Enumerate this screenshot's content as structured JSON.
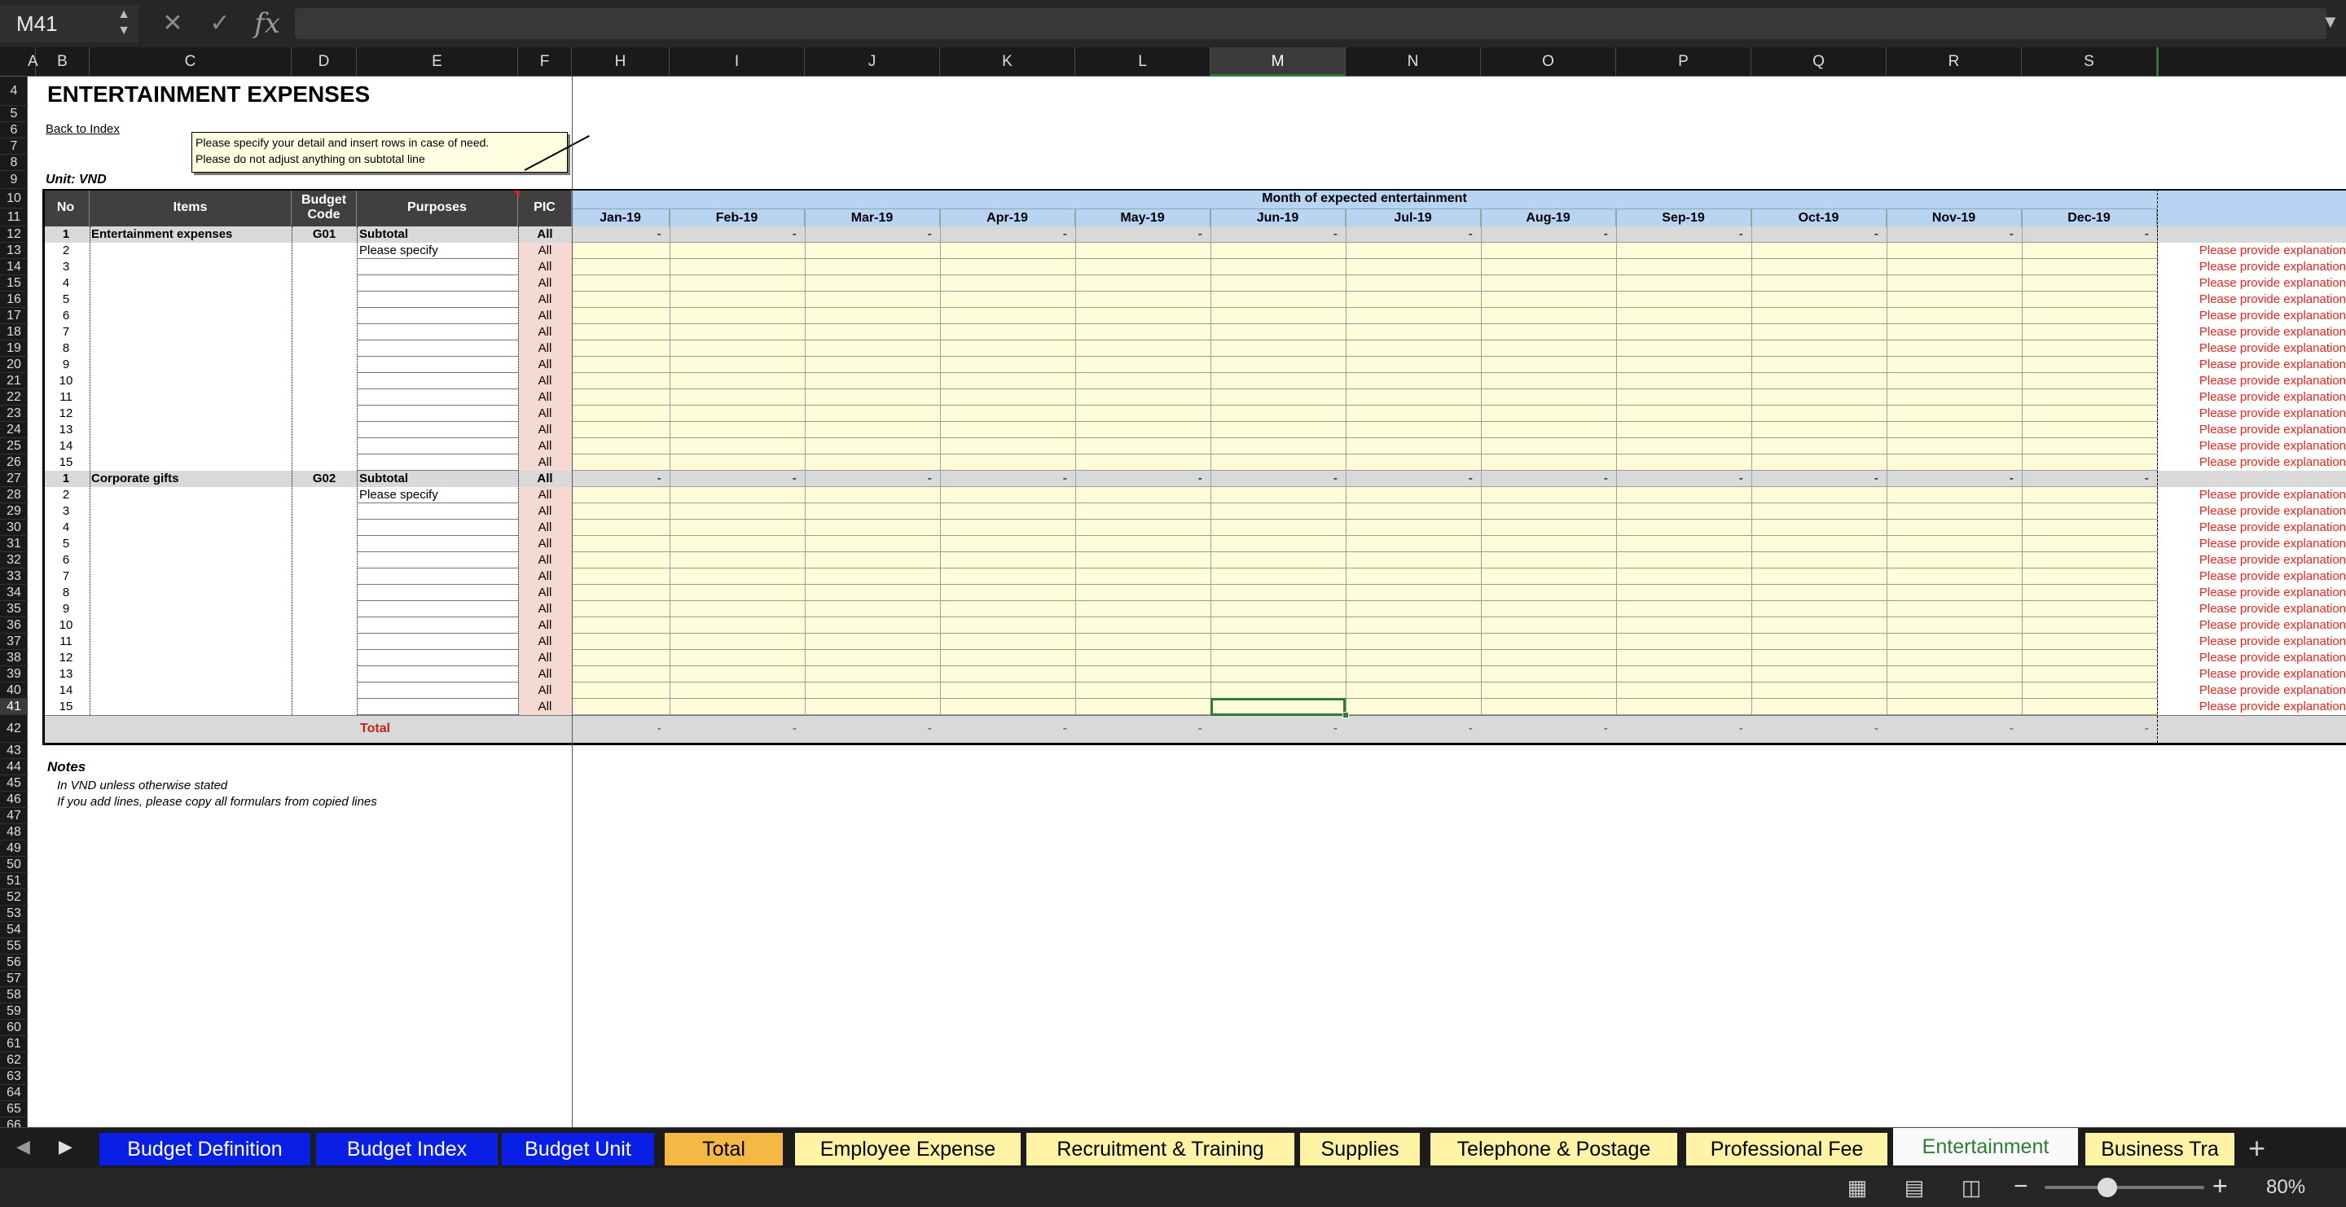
{
  "formula_bar": {
    "cell_ref": "M41",
    "cancel_icon": "✕",
    "enter_icon": "✓",
    "fx_label": "fx",
    "formula": ""
  },
  "columns": [
    "A",
    "B",
    "C",
    "D",
    "E",
    "F",
    "H",
    "I",
    "J",
    "K",
    "L",
    "M",
    "N",
    "O",
    "P",
    "Q",
    "R",
    "S"
  ],
  "sheet": {
    "title": "ENTERTAINMENT EXPENSES",
    "back_link": "Back to Index",
    "note_line1": "Please specify your detail and insert rows in case of need.",
    "note_line2": "Please do not adjust anything on subtotal line",
    "unit": "Unit: VND",
    "headers": {
      "no": "No",
      "items": "Items",
      "budget_code": "Budget Code",
      "purposes": "Purposes",
      "pic": "PIC",
      "month_group": "Month of expected entertainment"
    },
    "months": [
      "Jan-19",
      "Feb-19",
      "Mar-19",
      "Apr-19",
      "May-19",
      "Jun-19",
      "Jul-19",
      "Aug-19",
      "Sep-19",
      "Oct-19",
      "Nov-19",
      "Dec-19"
    ],
    "sections": [
      {
        "no": "1",
        "item": "Entertainment expenses",
        "code": "G01",
        "purpose": "Subtotal",
        "pic": "All"
      },
      {
        "no": "1",
        "item": "Corporate gifts",
        "code": "G02",
        "purpose": "Subtotal",
        "pic": "All"
      }
    ],
    "detail_first_purpose": "Please specify",
    "pic_value": "All",
    "dash": "-",
    "explain_text": "Please provide explanation",
    "total_label": "Total",
    "notes_title": "Notes",
    "note_1": "In VND unless otherwise stated",
    "note_2": "If you add lines, please copy all formulars from copied lines"
  },
  "tabs": [
    {
      "label": "Budget Definition",
      "style": "blue"
    },
    {
      "label": "Budget Index",
      "style": "blue"
    },
    {
      "label": "Budget Unit",
      "style": "blue"
    },
    {
      "label": "Total",
      "style": "orange"
    },
    {
      "label": "Employee Expense",
      "style": "yellow"
    },
    {
      "label": "Recruitment & Training",
      "style": "yellow"
    },
    {
      "label": "Supplies",
      "style": "yellow"
    },
    {
      "label": "Telephone & Postage",
      "style": "yellow"
    },
    {
      "label": "Professional Fee",
      "style": "yellow"
    },
    {
      "label": "Entertainment",
      "style": "active"
    },
    {
      "label": "Business Tra",
      "style": "yellow"
    }
  ],
  "status_bar": {
    "zoom": "80%",
    "zoom_minus": "−",
    "zoom_plus": "+",
    "add_sheet": "+"
  },
  "colors": {
    "blue_tab": "#0a1fe6",
    "orange_tab": "#f4b942",
    "yellow_tab": "#fff3a6",
    "active_tab_text": "#2e7d32",
    "header_dark": "#404040",
    "month_header": "#b9d3f2",
    "input_yellow": "#fffcd9",
    "subtotal_gray": "#d9d9d9",
    "explain_red": "#e8231e",
    "pic_pink": "#f7d9d3"
  }
}
